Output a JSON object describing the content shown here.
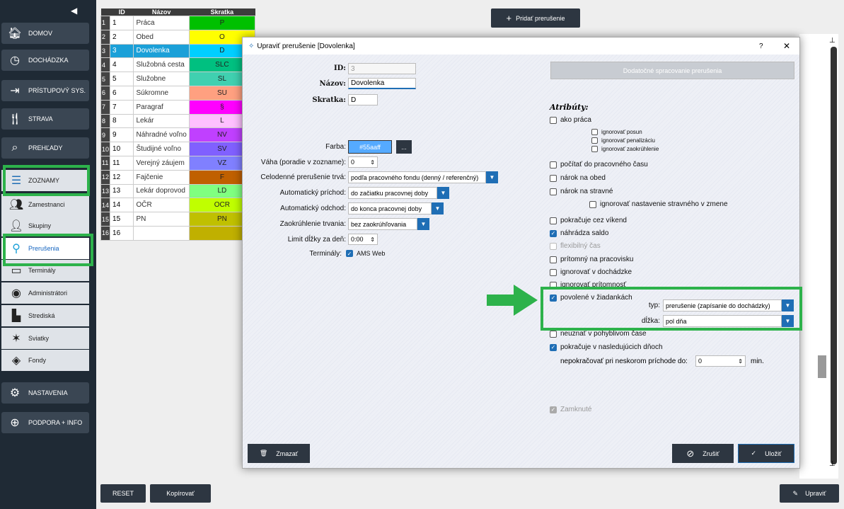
{
  "sidebar": {
    "main_items": [
      {
        "label": "DOMOV",
        "icon": "home-icon"
      },
      {
        "label": "DOCHÁDZKA",
        "icon": "clock-icon"
      },
      {
        "label": "PRÍSTUPOVÝ SYS.",
        "icon": "login-icon"
      },
      {
        "label": "STRAVA",
        "icon": "cutlery-icon"
      },
      {
        "label": "PREHĽADY",
        "icon": "search-icon"
      },
      {
        "label": "ZOZNAMY",
        "icon": "list-icon"
      }
    ],
    "sub_items": [
      {
        "label": "Zamestnanci",
        "icon": "employees-icon"
      },
      {
        "label": "Skupiny",
        "icon": "groups-icon"
      },
      {
        "label": "Prerušenia",
        "icon": "location-pin-icon"
      },
      {
        "label": "Terminály",
        "icon": "terminal-icon"
      },
      {
        "label": "Administrátori",
        "icon": "admin-icon"
      },
      {
        "label": "Strediská",
        "icon": "building-icon"
      },
      {
        "label": "Sviatky",
        "icon": "celebration-icon"
      },
      {
        "label": "Fondy",
        "icon": "layers-icon"
      }
    ],
    "bottom_items": [
      {
        "label": "NASTAVENIA",
        "icon": "gear-icon"
      },
      {
        "label": "PODPORA + INFO",
        "icon": "support-icon"
      }
    ]
  },
  "table": {
    "headers": [
      "ID",
      "Názov",
      "Skratka"
    ],
    "rows": [
      {
        "n": "1",
        "id": "1",
        "name": "Práca",
        "abbr": "P",
        "color": "#00c000"
      },
      {
        "n": "2",
        "id": "2",
        "name": "Obed",
        "abbr": "O",
        "color": "#ffff00"
      },
      {
        "n": "3",
        "id": "3",
        "name": "Dovolenka",
        "abbr": "D",
        "color": "#00cfff"
      },
      {
        "n": "4",
        "id": "4",
        "name": "Služobná cesta",
        "abbr": "SLC",
        "color": "#00c080"
      },
      {
        "n": "5",
        "id": "5",
        "name": "Služobne",
        "abbr": "SL",
        "color": "#40d0b0"
      },
      {
        "n": "6",
        "id": "6",
        "name": "Súkromne",
        "abbr": "SU",
        "color": "#ffa080"
      },
      {
        "n": "7",
        "id": "7",
        "name": "Paragraf",
        "abbr": "§",
        "color": "#ff00ff"
      },
      {
        "n": "8",
        "id": "8",
        "name": "Lekár",
        "abbr": "L",
        "color": "#ffc0ff"
      },
      {
        "n": "9",
        "id": "9",
        "name": "Náhradné voľno",
        "abbr": "NV",
        "color": "#c040ff"
      },
      {
        "n": "10",
        "id": "10",
        "name": "Študijné voľno",
        "abbr": "SV",
        "color": "#8060ff"
      },
      {
        "n": "11",
        "id": "11",
        "name": "Verejný záujem",
        "abbr": "VZ",
        "color": "#8080ff"
      },
      {
        "n": "12",
        "id": "12",
        "name": "Fajčenie",
        "abbr": "F",
        "color": "#c06000"
      },
      {
        "n": "13",
        "id": "13",
        "name": "Lekár doprovod",
        "abbr": "LD",
        "color": "#80ff80"
      },
      {
        "n": "14",
        "id": "14",
        "name": "OČR",
        "abbr": "OCR",
        "color": "#c0ff00"
      },
      {
        "n": "15",
        "id": "15",
        "name": "PN",
        "abbr": "PN",
        "color": "#c0c000"
      },
      {
        "n": "16",
        "id": "16",
        "name": "",
        "abbr": "",
        "color": "#c0b000"
      }
    ]
  },
  "toolbar": {
    "add_label": "Pridať prerušenie",
    "reset_label": "RESET",
    "copy_label": "Kopírovať",
    "edit_label": "Upraviť"
  },
  "dialog": {
    "title": "Upraviť prerušenie [Dovolenka]",
    "help": "?",
    "close": "✕",
    "id_label": "ID:",
    "id_value": "3",
    "name_label": "Názov:",
    "name_value": "Dovolenka",
    "abbr_label": "Skratka:",
    "abbr_value": "D",
    "color_label": "Farba:",
    "color_value": "#55aaff",
    "color_btn": "...",
    "weight_label": "Váha (poradie v zozname):",
    "weight_value": "0",
    "fullday_label": "Celodenné prerušenie trvá:",
    "fullday_value": "podľa pracovného fondu (denný / referenčný)",
    "auto_in_label": "Automatický príchod:",
    "auto_in_value": "do začiatku pracovnej doby",
    "auto_out_label": "Automatický odchod:",
    "auto_out_value": "do konca pracovnej doby",
    "round_label": "Zaokrúhlenie trvania:",
    "round_value": "bez zaokrúhľovania",
    "limit_label": "Limit dĺžky za deň:",
    "limit_value": "0:00",
    "terminals_label": "Terminály:",
    "terminal_ams": "AMS Web",
    "extra_btn": "Dodatočné spracovanie prerušenia",
    "attrs_title": "Atribúty:",
    "attrs": {
      "ako_praca": "ako práca",
      "ign_posun": "ignorovať posun",
      "ign_penal": "ignorovať penalizáciu",
      "ign_zaokr": "ignorovať zaokrúhlenie",
      "pocitat": "počítať do pracovného času",
      "obed": "nárok na obed",
      "stravne": "nárok na stravné",
      "ign_stravne": "ignorovať nastavenie stravného v zmene",
      "vikend": "pokračuje cez víkend",
      "saldo": "náhrádza saldo",
      "flex": "flexibilný čas",
      "pritomny": "prítomný na pracovisku",
      "ign_doch": "ignorovať v dochádzke",
      "ign_prit": "ignorovať prítomnosť",
      "povolene": "povolené v žiadankách",
      "neuznat": "neuznať v pohyblivom čase",
      "nasled": "pokračuje v nasledujúcich dňoch"
    },
    "type_label": "typ:",
    "type_value": "prerušenie (zapísanie do dochádzky)",
    "length_label": "dĺžka:",
    "length_value": "pol dňa",
    "late_label": "nepokračovať pri neskorom príchode do:",
    "late_value": "0",
    "late_unit": "min.",
    "locked": "Zamknuté",
    "delete_btn": "Zmazať",
    "cancel_btn": "Zrušiť",
    "save_btn": "Uložiť"
  }
}
